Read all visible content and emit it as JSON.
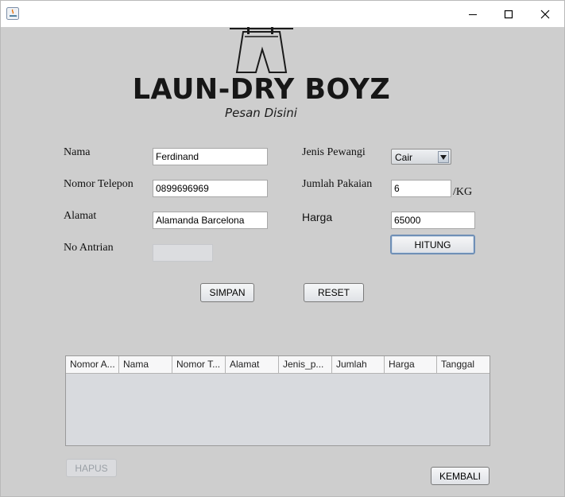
{
  "window": {
    "title": "",
    "controls": {
      "minimize": "minimize",
      "maximize": "maximize",
      "close": "close"
    }
  },
  "header": {
    "logo_text": "LAUN-DRY BOYZ",
    "subtitle": "Pesan Disini"
  },
  "form": {
    "nama": {
      "label": "Nama",
      "value": "Ferdinand"
    },
    "telepon": {
      "label": "Nomor Telepon",
      "value": "0899696969"
    },
    "alamat": {
      "label": "Alamat",
      "value": "Alamanda Barcelona"
    },
    "antrian": {
      "label": "No Antrian",
      "value": ""
    },
    "pewangi": {
      "label": "Jenis Pewangi",
      "value": "Cair"
    },
    "jumlah": {
      "label": "Jumlah Pakaian",
      "value": "6",
      "unit": "/KG"
    },
    "harga": {
      "label": "Harga",
      "value": "65000"
    }
  },
  "buttons": {
    "hitung": "HITUNG",
    "simpan": "SIMPAN",
    "reset": "RESET",
    "hapus": "HAPUS",
    "kembali": "KEMBALI"
  },
  "table": {
    "columns": [
      "Nomor A...",
      "Nama",
      "Nomor T...",
      "Alamat",
      "Jenis_p...",
      "Jumlah",
      "Harga",
      "Tanggal"
    ],
    "rows": []
  },
  "colors": {
    "background": "#cecece",
    "focus_border": "#6f8fb6"
  }
}
